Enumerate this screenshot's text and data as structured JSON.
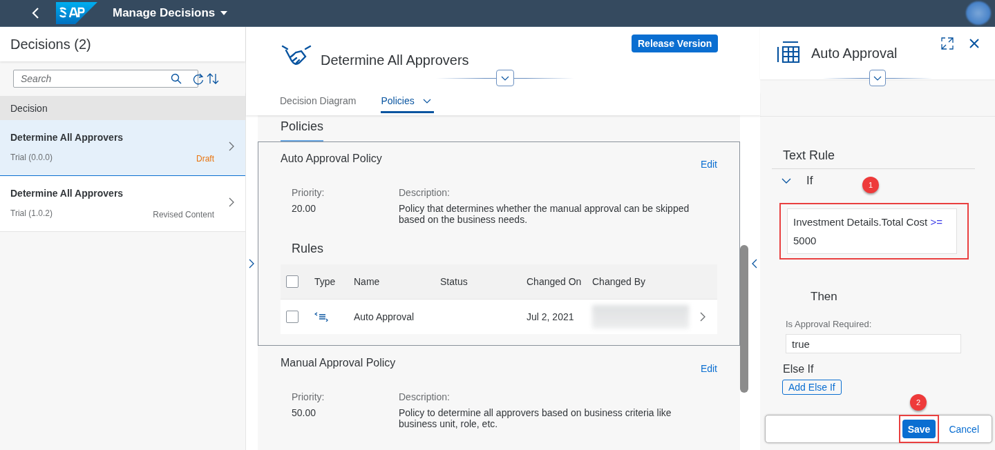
{
  "header": {
    "title": "Manage Decisions"
  },
  "list": {
    "title": "Decisions (2)",
    "search": {
      "placeholder": "Search"
    },
    "column": "Decision",
    "items": [
      {
        "name": "Determine All Approvers",
        "version": "Trial (0.0.0)",
        "status": "Draft",
        "color": "#e9730c",
        "selected": true
      },
      {
        "name": "Determine All Approvers",
        "version": "Trial (1.0.2)",
        "status": "Revised Content",
        "color": "#6a6d70",
        "selected": false
      }
    ]
  },
  "detail": {
    "title": "Determine All Approvers",
    "action": "Release Version",
    "tabs": [
      {
        "label": "Decision Diagram",
        "selected": false,
        "menu": false
      },
      {
        "label": "Policies",
        "selected": true,
        "menu": true
      }
    ],
    "section": "Policies",
    "policies": [
      {
        "name": "Auto Approval Policy",
        "edit": "Edit",
        "selected": true,
        "priority_label": "Priority:",
        "priority": "20.00",
        "description_label": "Description:",
        "description": "Policy that determines whether the manual approval can be skipped based on the business needs.",
        "rules": {
          "title": "Rules",
          "select_all_checked": false,
          "columns": [
            "Type",
            "Name",
            "Status",
            "Changed On",
            "Changed By"
          ],
          "rows": [
            {
              "checked": false,
              "name": "Auto Approval",
              "status": "",
              "changed_on": "Jul 2, 2021"
            }
          ]
        }
      },
      {
        "name": "Manual Approval Policy",
        "edit": "Edit",
        "selected": false,
        "priority_label": "Priority:",
        "priority": "50.00",
        "description_label": "Description:",
        "description": "Policy to determine all approvers based on business criteria like business unit, role, etc."
      }
    ]
  },
  "rule_panel": {
    "title": "Auto Approval",
    "section": "Text Rule",
    "if_label": "If",
    "expanded": true,
    "condition": "Investment Details.Total Cost",
    "operator": ">=",
    "value": "5000",
    "then_label": "Then",
    "field_label": "Is Approval Required:",
    "field_value": "true",
    "else_if": "Else If",
    "add_else_if": "Add Else If"
  },
  "footer": {
    "buttons": [
      {
        "label": "Save",
        "kind": "emphasized"
      },
      {
        "label": "Cancel",
        "kind": "transparent"
      }
    ]
  },
  "callouts": [
    {
      "label": "1"
    },
    {
      "label": "2"
    }
  ]
}
